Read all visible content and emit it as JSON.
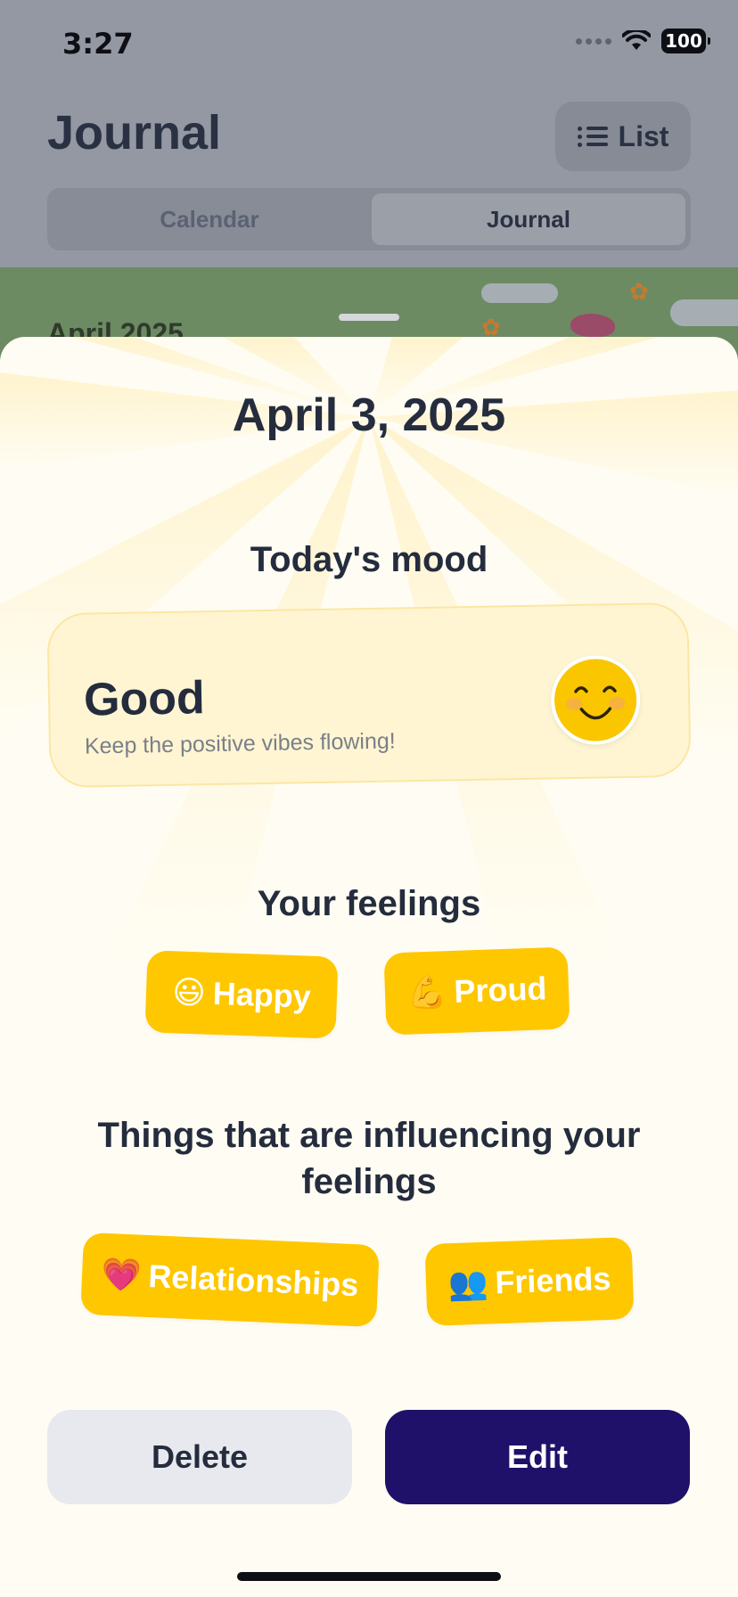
{
  "status_bar": {
    "time": "3:27",
    "battery": "100",
    "icons": [
      "signal-icon",
      "wifi-icon",
      "battery-icon"
    ]
  },
  "header": {
    "title": "Journal",
    "list_button_label": "List",
    "list_icon": "list-icon"
  },
  "segmented": {
    "tabs": [
      {
        "label": "Calendar",
        "selected": false
      },
      {
        "label": "Journal",
        "selected": true
      }
    ]
  },
  "background_banner": {
    "month_label": "April 2025"
  },
  "entry": {
    "date": "April 3, 2025",
    "mood_heading": "Today's mood",
    "mood": {
      "label": "Good",
      "message": "Keep the positive vibes flowing!",
      "icon": "smiling-face-icon"
    },
    "feelings_heading": "Your feelings",
    "feelings": [
      {
        "emoji": "😃",
        "label": "Happy",
        "icon": "grinning-face-icon"
      },
      {
        "emoji": "💪",
        "label": "Proud",
        "icon": "flexed-biceps-icon"
      }
    ],
    "influences_heading": "Things that are influencing your feelings",
    "influences": [
      {
        "emoji": "💗",
        "label": "Relationships",
        "icon": "heart-icon"
      },
      {
        "emoji": "👥",
        "label": "Friends",
        "icon": "people-icon"
      }
    ]
  },
  "actions": {
    "delete_label": "Delete",
    "edit_label": "Edit"
  },
  "colors": {
    "chip": "#ffc700",
    "edit_button": "#1f1069",
    "delete_button": "#e7e9ee",
    "text_dark": "#242c3d",
    "mood_card": "#fff5d2"
  }
}
